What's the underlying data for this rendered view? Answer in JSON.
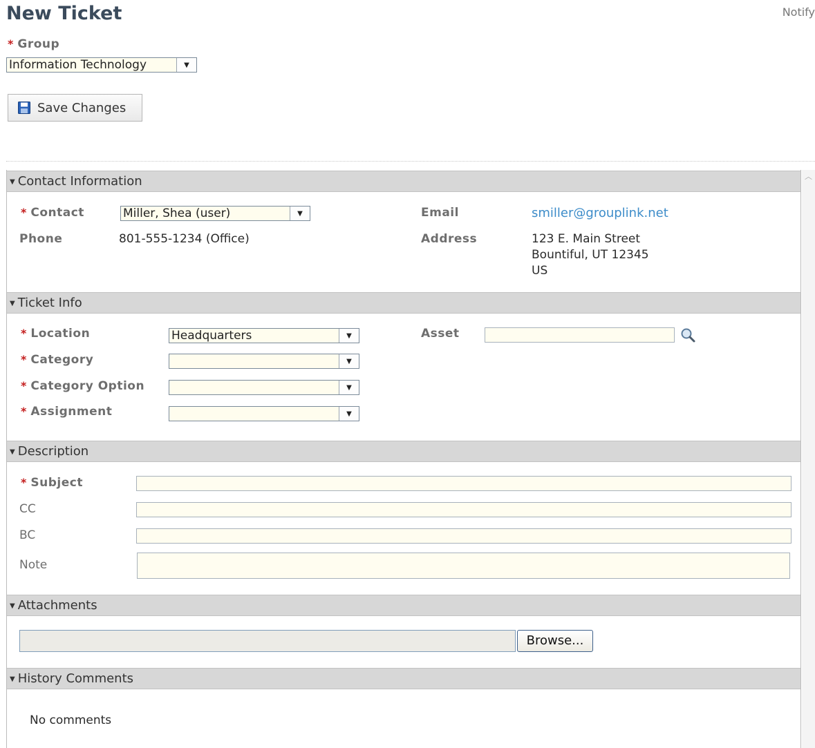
{
  "page": {
    "title": "New Ticket",
    "notify_label": "Notify"
  },
  "group": {
    "label": "Group",
    "value": "Information Technology"
  },
  "toolbar": {
    "save_label": "Save Changes"
  },
  "colors": {
    "required": "#c41e1e",
    "section_header": "#d7d7d7",
    "link": "#3d8cc9",
    "title": "#3b4b5c"
  },
  "sections": {
    "contact": {
      "title": "Contact Information",
      "contact_label": "Contact",
      "contact_value": "Miller, Shea (user)",
      "phone_label": "Phone",
      "phone_value": "801-555-1234 (Office)",
      "email_label": "Email",
      "email_value": "smiller@grouplink.net",
      "address_label": "Address",
      "address_line1": "123 E. Main Street",
      "address_line2": "Bountiful, UT 12345",
      "address_line3": "US"
    },
    "ticket_info": {
      "title": "Ticket Info",
      "location_label": "Location",
      "location_value": "Headquarters",
      "category_label": "Category",
      "category_value": "",
      "category_option_label": "Category Option",
      "category_option_value": "",
      "assignment_label": "Assignment",
      "assignment_value": "",
      "asset_label": "Asset",
      "asset_value": ""
    },
    "description": {
      "title": "Description",
      "subject_label": "Subject",
      "cc_label": "CC",
      "bc_label": "BC",
      "note_label": "Note"
    },
    "attachments": {
      "title": "Attachments",
      "browse_label": "Browse..."
    },
    "history": {
      "title": "History Comments",
      "empty_text": "No comments"
    }
  },
  "icons": {
    "save": "floppy-disk-icon",
    "search": "magnifier-icon",
    "collapse": "triangle-down-icon",
    "dropdown": "chevron-down-icon"
  }
}
